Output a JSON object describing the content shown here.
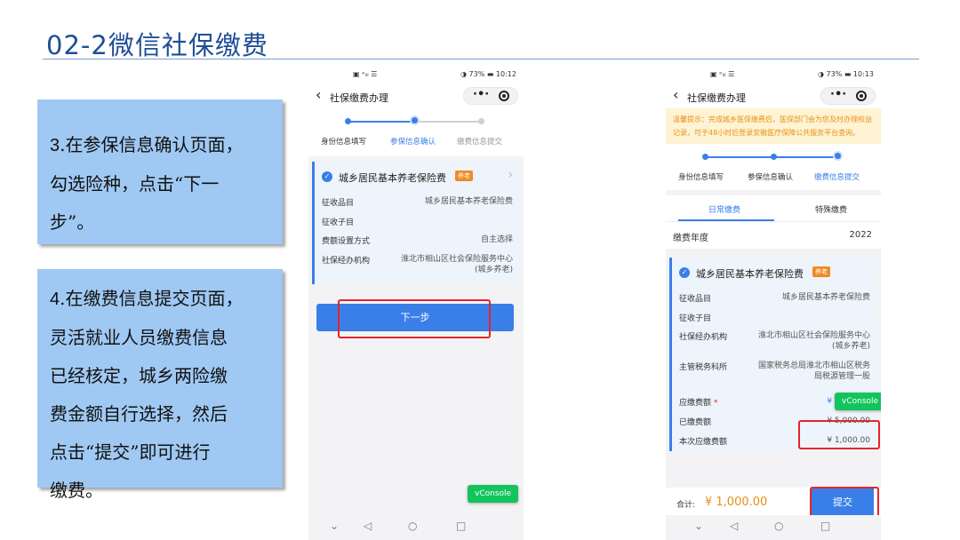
{
  "title": "02-2微信社保缴费",
  "note1": {
    "num": "3",
    "text_a": ".在参保信息确认页面，",
    "text_b": "勾选险种，点击“下一",
    "text_c": "步”。"
  },
  "note2": {
    "num": "4",
    "text_a": ".在缴费信息提交页面，",
    "lines": [
      "灵活就业人员缴费信息",
      "已经核定，城乡两险缴",
      "费金额自行选择，然后",
      "点击“提交”即可进行",
      "缴费。"
    ]
  },
  "phone1": {
    "status": {
      "carrier": "▣ ᵊᵢₗₗ ☰",
      "right": "◑ 73% ▬ 10:12"
    },
    "nav_title": "社保缴费办理",
    "steps": [
      "身份信息填写",
      "参保信息确认",
      "缴费信息提交"
    ],
    "card_title": "城乡居民基本养老保险费",
    "tag": "养老",
    "rows": [
      {
        "k": "征收品目",
        "v": "城乡居民基本养老保险费"
      },
      {
        "k": "征收子目",
        "v": ""
      },
      {
        "k": "费额设置方式",
        "v": "自主选择"
      },
      {
        "k": "社保经办机构",
        "v": "淮北市相山区社会保险服务中心",
        "v2": "(城乡养老)"
      }
    ],
    "next": "下一步",
    "vconsole": "vConsole"
  },
  "phone2": {
    "status": {
      "carrier": "▣ ᵊᵢₗₗ ☰",
      "right": "◑ 73% ▬ 10:13"
    },
    "nav_title": "社保缴费办理",
    "notice": "温馨提示：完成城乡医保缴费后，医保部门会为您及时办理权益记录，可于48小时后登录安徽医疗保障公共服务平台查询。",
    "steps": [
      "身份信息填写",
      "参保信息确认",
      "缴费信息提交"
    ],
    "tabs": [
      "日常缴费",
      "特殊缴费"
    ],
    "year_label": "缴费年度",
    "year": "2022",
    "card_title": "城乡居民基本养老保险费",
    "tag": "养老",
    "rows": [
      {
        "k": "征收品目",
        "v": "城乡居民基本养老保险费"
      },
      {
        "k": "征收子目",
        "v": ""
      },
      {
        "k": "社保经办机构",
        "v": "淮北市相山区社会保险服务中心",
        "v2": "(城乡养老)"
      },
      {
        "k": "主管税务科所",
        "v": "国家税务总局淮北市相山区税务",
        "v2": "局税源管理一股"
      }
    ],
    "due_label": "应缴费额",
    "due": "¥ 6,000.00",
    "paid_label": "已缴费额",
    "paid": "¥ 5,000.00",
    "cur_label": "本次应缴费额",
    "cur": "¥ 1,000.00",
    "total_label": "合计:",
    "total": "¥ 1,000.00",
    "submit": "提交",
    "vconsole": "vConsole"
  }
}
